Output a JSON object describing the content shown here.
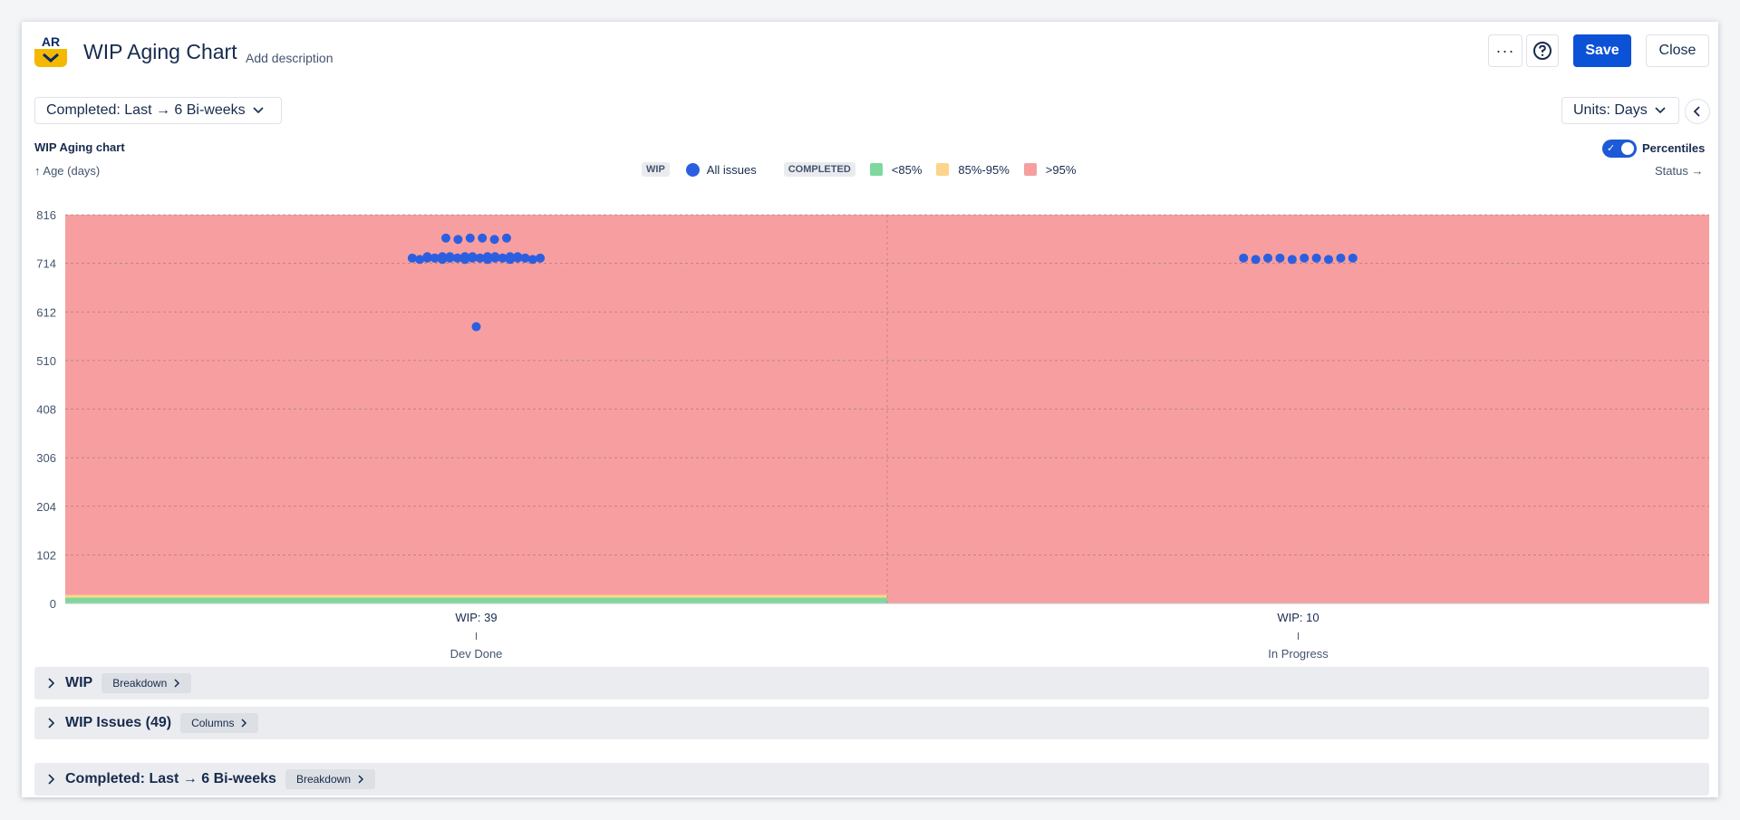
{
  "app": {
    "logo_text": "AR",
    "title": "WIP Aging Chart",
    "add_description": "Add description"
  },
  "toolbar": {
    "more_label": "···",
    "save_label": "Save",
    "close_label": "Close"
  },
  "filters": {
    "completed_range": "Completed: Last → 6 Bi-weeks",
    "units": "Units: Days"
  },
  "chart_header": {
    "label": "WIP Aging chart",
    "percentiles_label": "Percentiles",
    "percentiles_on": true
  },
  "legend": {
    "wip_tag": "WIP",
    "all_issues": "All issues",
    "completed_tag": "COMPLETED",
    "lt85": "<85%",
    "mid": "85%-95%",
    "gt95": ">95%"
  },
  "colors": {
    "dot": "#2c5fe0",
    "lt85": "#7fd89b",
    "mid": "#fdd48c",
    "gt95": "#f79fa0",
    "accent": "#0c52d6"
  },
  "chart_data": {
    "type": "scatter",
    "ylabel": "↑ Age (days)",
    "xlabel": "Status →",
    "ylim": [
      0,
      816
    ],
    "y_ticks": [
      "816",
      "714",
      "612",
      "510",
      "408",
      "306",
      "204",
      "102",
      "0"
    ],
    "grid": true,
    "legend_position": "top-center",
    "categories": [
      {
        "name": "Dev Done",
        "wip_label": "WIP: 39",
        "percentile_bands": {
          "lt85": 12,
          "mid": 18,
          "gt95": 816
        },
        "points": [
          767,
          767,
          767,
          767,
          767,
          767,
          728,
          728,
          728,
          728,
          728,
          728,
          728,
          728,
          728,
          728,
          728,
          728,
          728,
          728,
          725,
          725,
          725,
          725,
          725,
          725,
          725,
          725,
          725,
          725,
          725,
          725,
          725,
          725,
          725,
          725,
          725,
          725,
          581
        ]
      },
      {
        "name": "In Progress",
        "wip_label": "WIP: 10",
        "percentile_bands": {
          "lt85": 0,
          "mid": 0,
          "gt95": 816
        },
        "points": [
          725,
          725,
          725,
          725,
          725,
          725,
          725,
          725,
          725,
          725
        ]
      }
    ]
  },
  "sections": [
    {
      "title": "WIP",
      "pill": "Breakdown"
    },
    {
      "title": "WIP Issues (49)",
      "pill": "Columns"
    },
    {
      "title": "Completed: Last → 6 Bi-weeks",
      "pill": "Breakdown"
    }
  ]
}
